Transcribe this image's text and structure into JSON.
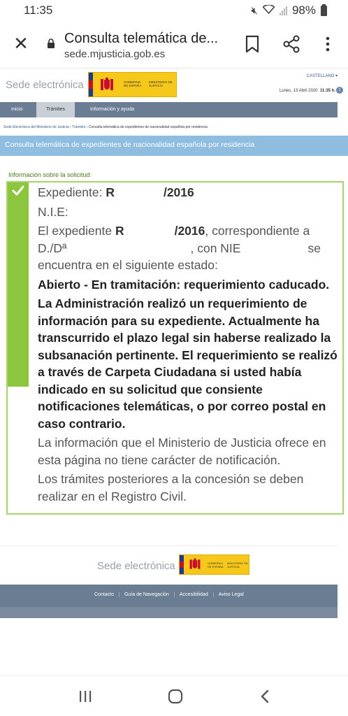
{
  "status_bar": {
    "time": "11:35",
    "battery": "98%"
  },
  "browser": {
    "page_title": "Consulta telemática de...",
    "url": "sede.mjusticia.gob.es"
  },
  "header": {
    "sede_label": "Sede electrónica",
    "logo_gov": "GOBIERNO DE ESPAÑA",
    "logo_ministry": "MINISTERIO DE JUSTICIA",
    "language": "CASTELLANO ▾",
    "date": "Lunes, 13 Abril 2020",
    "time": "11:35 h.",
    "info_icon": "i"
  },
  "nav": {
    "items": [
      {
        "label": "Inicio"
      },
      {
        "label": "Trámites"
      },
      {
        "label": "Información y ayuda"
      }
    ]
  },
  "breadcrumb": {
    "home": "Sede Electrónica del Ministerio de Justicia",
    "section": "Trámites",
    "current": "Consulta telemática de expedientes de nacionalidad española por residencia",
    "separator": "›"
  },
  "page_title": "Consulta telemática de expedientes de nacionalidad española por residencia",
  "info_label": "Información sobre la solicitud:",
  "result": {
    "expediente_label": "Expediente:",
    "expediente_prefix": "R",
    "expediente_suffix": "/2016",
    "nie_label": "N.I.E:",
    "sentence_part1": "El expediente",
    "sentence_prefix": "R",
    "sentence_suffix": "/2016",
    "sentence_part2": ", correspondiente a D./Dª",
    "sentence_part3": ", con NIE",
    "sentence_part4": "se encuentra en el siguiente estado:",
    "status": "Abierto - En tramitación: requerimiento caducado.",
    "explanation": "La Administración realizó un requerimiento de información para su expediente. Actualmente ha transcurrido el plazo legal sin haberse realizado la subsanación pertinente. El requerimiento se realizó a través de Carpeta Ciudadana si usted había indicado en su solicitud que consiente notificaciones telemáticas, o por correo postal en caso contrario.",
    "disclaimer": "La información que el Ministerio de Justicia ofrece en esta página no tiene carácter de notificación.",
    "note": "Los trámites posteriores a la concesión se deben realizar en el Registro Civil."
  },
  "footer": {
    "sede_label": "Sede electrónica",
    "logo_gov": "GOBIERNO DE ESPAÑA",
    "logo_ministry": "MINISTERIO DE JUSTICIA",
    "links": [
      "Contacto",
      "Guía de Navegación",
      "Accesibilidad",
      "Aviso Legal"
    ]
  },
  "colors": {
    "nav_bg": "#6b7d93",
    "title_bar": "#8fbde0",
    "success_green": "#8cc63f",
    "logo_yellow": "#f6c81a"
  },
  "icons": [
    "close-icon",
    "lock-icon",
    "bookmark-icon",
    "share-icon",
    "more-vert-icon",
    "check-icon",
    "info-icon",
    "recents-icon",
    "home-icon",
    "back-icon"
  ]
}
